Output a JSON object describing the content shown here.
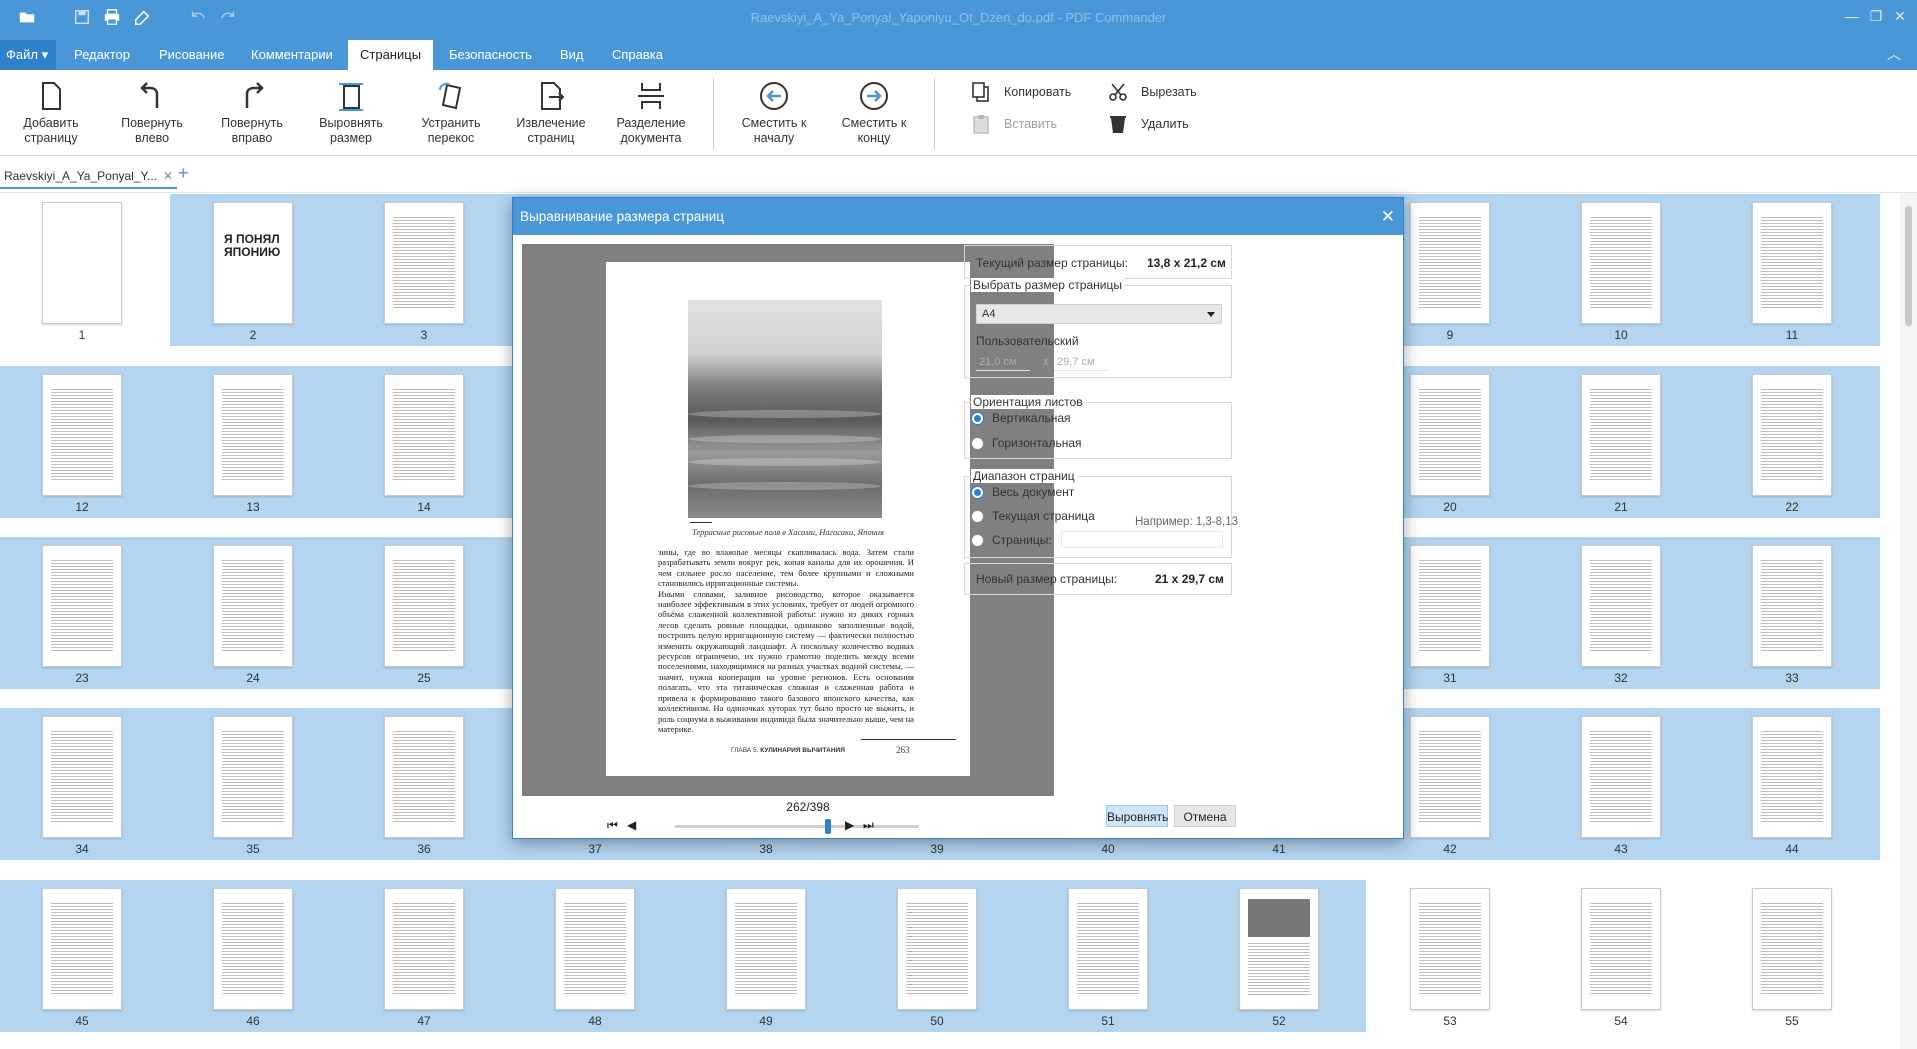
{
  "app": {
    "title": "Raevskiyi_A_Ya_Ponyal_Yaponiyu_Ot_Dzen_do.pdf - PDF Commander",
    "file_menu": "Файл",
    "tabs": [
      "Редактор",
      "Рисование",
      "Комментарии",
      "Страницы",
      "Безопасность",
      "Вид",
      "Справка"
    ],
    "active_tab": "Страницы"
  },
  "ribbon": {
    "buttons": [
      {
        "label": "Добавить\nстраницу",
        "icon": "add-page-icon"
      },
      {
        "label": "Повернуть\nвлево",
        "icon": "rotate-left-icon"
      },
      {
        "label": "Повернуть\nвправо",
        "icon": "rotate-right-icon"
      },
      {
        "label": "Выровнять\nразмер",
        "icon": "align-size-icon"
      },
      {
        "label": "Устранить\nперекос",
        "icon": "deskew-icon"
      },
      {
        "label": "Извлечение\nстраниц",
        "icon": "extract-pages-icon"
      },
      {
        "label": "Разделение\nдокумента",
        "icon": "split-document-icon"
      },
      {
        "label": "Сместить к\nначалу",
        "icon": "move-to-start-icon"
      },
      {
        "label": "Сместить к\nконцу",
        "icon": "move-to-end-icon"
      }
    ],
    "copy": "Копировать",
    "paste": "Вставить",
    "cut": "Вырезать",
    "delete": "Удалить"
  },
  "document_tab": {
    "name": "Raevskiyi_A_Ya_Ponyal_Y...",
    "add": "+"
  },
  "thumbnails": {
    "rows": [
      [
        "1",
        "2",
        "3",
        "",
        "",
        "",
        "",
        "",
        "9",
        "10",
        "11"
      ],
      [
        "12",
        "13",
        "14",
        "",
        "",
        "",
        "",
        "",
        "20",
        "21",
        "22"
      ],
      [
        "23",
        "24",
        "25",
        "",
        "",
        "",
        "",
        "",
        "31",
        "32",
        "33"
      ],
      [
        "34",
        "35",
        "36",
        "37",
        "38",
        "39",
        "40",
        "41",
        "42",
        "43",
        "44"
      ],
      [
        "45",
        "46",
        "47",
        "48",
        "49",
        "50",
        "51",
        "52",
        "53",
        "54",
        "55"
      ]
    ]
  },
  "dialog": {
    "title": "Выравнивание размера страниц",
    "current_size_label": "Текущий размер страницы:",
    "current_size_value": "13,8 x 21,2 см",
    "choose_size_title": "Выбрать размер страницы",
    "selected_size": "A4",
    "custom_label": "Пользовательский",
    "custom_width": "21,0 см",
    "custom_x": "x",
    "custom_height": "29,7 см",
    "orientation_title": "Ориентация листов",
    "orientation_portrait": "Вертикальная",
    "orientation_landscape": "Горизонтальная",
    "range_title": "Диапазон страниц",
    "range_all": "Весь документ",
    "range_current": "Текущая страница",
    "range_pages": "Страницы:",
    "range_hint": "Например: 1,3-8,13",
    "new_size_label": "Новый размер страницы:",
    "new_size_value": "21 x 29,7 см",
    "apply": "Выровнять",
    "cancel": "Отмена",
    "page_counter": "262/398",
    "preview": {
      "caption": "Террасные рисовые поля в Хасами, Нагасаки, Япония",
      "body": "зины, где во влажные месяцы скапливалась вода. Затем стали разрабатывать земли вокруг рек, копая каналы для их орошения. И чем сильнее росло население, тем более крупными и сложными становились ирригационные системы.\n  Иными словами, заливное рисоводство, которое оказывается наиболее эффективным в этих условиях, требует от людей огромного объёма слаженной коллективной работы: нужно из диких горных лесов сделать ровные площадки, одинаково заполненные водой, построить целую ирригационную систему — фактически полностью изменить окружающий ландшафт. А поскольку количество водных ресурсов ограничено, их нужно грамотно поделить между всеми поселениями, находящимися на разных участках водной системы, — значит, нужна кооперация на уровне регионов. Есть основания полагать, что эта титаническая сложная и слаженная работа и привела к формированию такого базового японского качества, как коллективизм. На одиночках хуторах тут было просто не выжить, и роль социума в выживании индивида была значительно выше, чем на материке.",
      "footer_chapter": "ГЛАВА 5.",
      "footer_title": "КУЛИНАРИЯ ВЫЧИТАНИЯ",
      "page_number": "263"
    }
  }
}
